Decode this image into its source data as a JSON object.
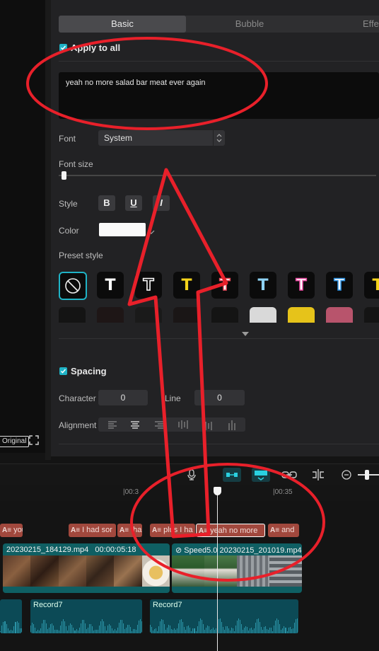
{
  "tabs": [
    "Basic",
    "Bubble",
    "Effe"
  ],
  "apply_to_all": "Apply to all",
  "text_value": "yeah no more salad bar meat ever again",
  "font_label": "Font",
  "font_value": "System",
  "font_size_label": "Font size",
  "font_size_level": 0.01,
  "style_label": "Style",
  "style_buttons": [
    "B",
    "U",
    "I"
  ],
  "color_label": "Color",
  "color_value": "#fafafa",
  "preset_label": "Preset style",
  "presets": [
    {
      "glyph": "",
      "color": "#ffffff",
      "stroke": "",
      "icon": "none-icon"
    },
    {
      "glyph": "T",
      "color": "#ffffff",
      "stroke": "",
      "icon": "text-white-icon"
    },
    {
      "glyph": "T",
      "color": "#0b0b0b",
      "stroke": "#ffffff",
      "icon": "text-outline-icon"
    },
    {
      "glyph": "T",
      "color": "#f5d31b",
      "stroke": "",
      "icon": "text-yellow-icon"
    },
    {
      "glyph": "T",
      "color": "#ffffff",
      "stroke": "#e84a5a",
      "icon": "text-red-outline-icon"
    },
    {
      "glyph": "T",
      "color": "#8fd3f4",
      "stroke": "",
      "icon": "text-lightblue-icon"
    },
    {
      "glyph": "T",
      "color": "#ffffff",
      "stroke": "#e84aa0",
      "icon": "text-pink-outline-icon"
    },
    {
      "glyph": "T",
      "color": "#ffffff",
      "stroke": "#2a8fe0",
      "icon": "text-blue-outline-icon"
    },
    {
      "glyph": "T",
      "color": "#f5d31b",
      "stroke": "",
      "icon": "text-yellow2-icon"
    }
  ],
  "spacing_label": "Spacing",
  "character_label": "Character",
  "character_value": "0",
  "line_label": "Line",
  "line_value": "0",
  "alignment_label": "Alignment",
  "original_label": "Original",
  "ruler_labels": [
    "|00:3",
    "|00:35"
  ],
  "text_clips": [
    {
      "label": "you"
    },
    {
      "label": "I had sor"
    },
    {
      "label": "tha"
    },
    {
      "label": "plus I ha"
    },
    {
      "label": "yeah no more",
      "selected": true
    },
    {
      "label": "and"
    }
  ],
  "video_clips": [
    {
      "name": "20230215_184129.mp4",
      "duration": "00:00:05:18"
    },
    {
      "name": "Speed5.0",
      "second": "20230215_201019.mp4"
    }
  ],
  "audio_clips": [
    "Record7",
    "Record7"
  ]
}
